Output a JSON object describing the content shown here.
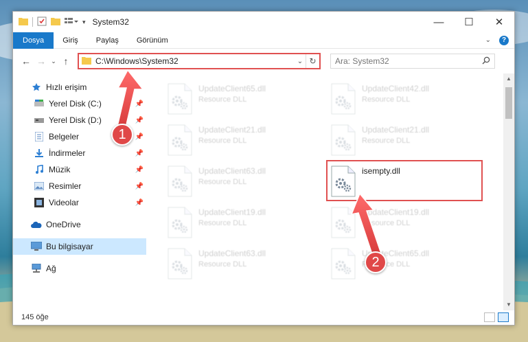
{
  "window": {
    "title": "System32",
    "controls": {
      "minimize": "—",
      "maximize": "☐",
      "close": "✕"
    }
  },
  "ribbon": {
    "tabs": [
      {
        "label": "Dosya"
      },
      {
        "label": "Giriş"
      },
      {
        "label": "Paylaş"
      },
      {
        "label": "Görünüm"
      }
    ],
    "help": "?"
  },
  "address": {
    "path": "C:\\Windows\\System32",
    "search_placeholder": "Ara: System32"
  },
  "sidebar": {
    "quick_access": "Hızlı erişim",
    "items": [
      {
        "label": "Yerel Disk (C:)",
        "icon": "drive-icon"
      },
      {
        "label": "Yerel Disk (D:)",
        "icon": "drive-icon"
      },
      {
        "label": "Belgeler",
        "icon": "documents-icon"
      },
      {
        "label": "İndirmeler",
        "icon": "downloads-icon"
      },
      {
        "label": "Müzik",
        "icon": "music-icon"
      },
      {
        "label": "Resimler",
        "icon": "pictures-icon"
      },
      {
        "label": "Videolar",
        "icon": "videos-icon"
      }
    ],
    "onedrive": "OneDrive",
    "this_pc": "Bu bilgisayar",
    "network": "Ağ"
  },
  "files": [
    {
      "name": "UpdateClient65.dll",
      "type": "Resource DLL"
    },
    {
      "name": "UpdateClient42.dll",
      "type": "Resource DLL"
    },
    {
      "name": "UpdateClient21.dll",
      "type": "Resource DLL"
    },
    {
      "name": "UpdateClient21.dll",
      "type": "Resource DLL"
    },
    {
      "name": "UpdateClient63.dll",
      "type": "Resource DLL"
    },
    {
      "name": "isempty.dll",
      "type": ""
    },
    {
      "name": "UpdateClient19.dll",
      "type": "Resource DLL"
    },
    {
      "name": "UpdateClient19.dll",
      "type": "Resource DLL"
    },
    {
      "name": "UpdateClient63.dll",
      "type": "Resource DLL"
    },
    {
      "name": "UpdateClient65.dll",
      "type": "Resource DLL"
    }
  ],
  "status": {
    "count": "145 öğe"
  },
  "callouts": {
    "one": "1",
    "two": "2"
  },
  "colors": {
    "accent": "#1979ca",
    "highlight": "#e05050",
    "selected": "#cce8ff"
  }
}
